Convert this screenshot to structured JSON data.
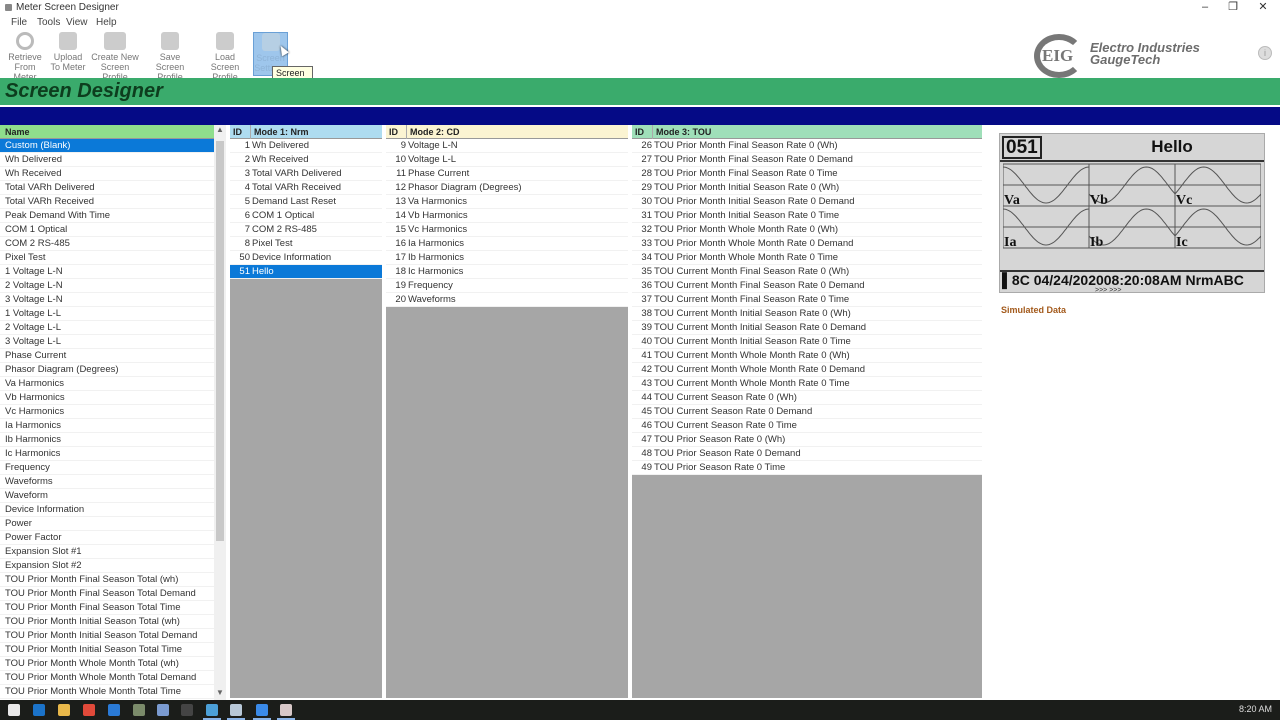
{
  "window": {
    "title": "Meter Screen Designer",
    "controls": [
      "minimize",
      "restore",
      "close"
    ]
  },
  "menu": [
    "File",
    "Tools",
    "View",
    "Help"
  ],
  "toolbar": [
    {
      "label1": "Retrieve",
      "label2": "From Meter",
      "icon": "refresh-icon"
    },
    {
      "label1": "Upload",
      "label2": "To Meter",
      "icon": "upload-icon"
    },
    {
      "label1": "Create New",
      "label2": "Screen Profile",
      "icon": "new-folder-icon"
    },
    {
      "label1": "Save",
      "label2": "Screen Profile",
      "icon": "save-icon"
    },
    {
      "label1": "Load",
      "label2": "Screen Profile",
      "icon": "load-icon"
    },
    {
      "label1": "Screen",
      "label2": "Settings",
      "icon": "settings-icon"
    }
  ],
  "tooltip": {
    "line1": "Screen",
    "line2": "Settings"
  },
  "logo": {
    "line1": "Electro Industries",
    "line2": "GaugeTech",
    "mark": "EIG"
  },
  "banner": {
    "title": "Screen Designer"
  },
  "left_list": {
    "header": "Name",
    "selected_index": 0,
    "items": [
      "Custom (Blank)",
      "Wh Delivered",
      "Wh Received",
      "Total VARh Delivered",
      "Total VARh Received",
      "Peak Demand With Time",
      "COM 1 Optical",
      "COM 2 RS-485",
      "Pixel Test",
      "1 Voltage L-N",
      "2 Voltage L-N",
      "3 Voltage L-N",
      "1 Voltage L-L",
      "2 Voltage L-L",
      "3 Voltage L-L",
      "Phase Current",
      "Phasor Diagram (Degrees)",
      "Va Harmonics",
      "Vb Harmonics",
      "Vc Harmonics",
      "Ia Harmonics",
      "Ib Harmonics",
      "Ic Harmonics",
      "Frequency",
      "Waveforms",
      "Waveform",
      "Device Information",
      "Power",
      "Power Factor",
      "Expansion Slot #1",
      "Expansion Slot #2",
      "TOU Prior Month Final Season Total (wh)",
      "TOU Prior Month Final Season Total Demand",
      "TOU Prior Month Final Season Total Time",
      "TOU Prior Month Initial Season Total (wh)",
      "TOU Prior Month Initial Season Total Demand",
      "TOU Prior Month Initial Season Total Time",
      "TOU Prior Month Whole Month Total (wh)",
      "TOU Prior Month Whole Month Total Demand",
      "TOU Prior Month Whole Month Total Time"
    ]
  },
  "mode1": {
    "id_header": "ID",
    "header": "Mode 1: Nrm",
    "selected_index": 9,
    "rows": [
      {
        "id": "1",
        "name": "Wh Delivered"
      },
      {
        "id": "2",
        "name": "Wh Received"
      },
      {
        "id": "3",
        "name": "Total VARh Delivered"
      },
      {
        "id": "4",
        "name": "Total VARh Received"
      },
      {
        "id": "5",
        "name": "Demand Last Reset"
      },
      {
        "id": "6",
        "name": "COM 1 Optical"
      },
      {
        "id": "7",
        "name": "COM 2 RS-485"
      },
      {
        "id": "8",
        "name": "Pixel Test"
      },
      {
        "id": "50",
        "name": "Device Information"
      },
      {
        "id": "51",
        "name": "Hello"
      }
    ]
  },
  "mode2": {
    "id_header": "ID",
    "header": "Mode 2: CD",
    "rows": [
      {
        "id": "9",
        "name": "Voltage L-N"
      },
      {
        "id": "10",
        "name": "Voltage L-L"
      },
      {
        "id": "11",
        "name": "Phase Current"
      },
      {
        "id": "12",
        "name": "Phasor Diagram (Degrees)"
      },
      {
        "id": "13",
        "name": "Va Harmonics"
      },
      {
        "id": "14",
        "name": "Vb Harmonics"
      },
      {
        "id": "15",
        "name": "Vc Harmonics"
      },
      {
        "id": "16",
        "name": "Ia Harmonics"
      },
      {
        "id": "17",
        "name": "Ib Harmonics"
      },
      {
        "id": "18",
        "name": "Ic Harmonics"
      },
      {
        "id": "19",
        "name": "Frequency"
      },
      {
        "id": "20",
        "name": "Waveforms"
      }
    ]
  },
  "mode3": {
    "id_header": "ID",
    "header": "Mode 3: TOU",
    "rows": [
      {
        "id": "26",
        "name": "TOU Prior Month Final Season Rate 0 (Wh)"
      },
      {
        "id": "27",
        "name": "TOU Prior Month Final Season Rate 0 Demand"
      },
      {
        "id": "28",
        "name": "TOU Prior Month Final Season Rate 0 Time"
      },
      {
        "id": "29",
        "name": "TOU Prior Month Initial Season Rate 0 (Wh)"
      },
      {
        "id": "30",
        "name": "TOU Prior Month Initial Season Rate 0 Demand"
      },
      {
        "id": "31",
        "name": "TOU Prior Month Initial Season Rate 0 Time"
      },
      {
        "id": "32",
        "name": "TOU Prior Month Whole Month Rate 0 (Wh)"
      },
      {
        "id": "33",
        "name": "TOU Prior Month Whole Month Rate 0 Demand"
      },
      {
        "id": "34",
        "name": "TOU Prior Month Whole Month Rate 0 Time"
      },
      {
        "id": "35",
        "name": "TOU Current Month Final Season Rate 0 (Wh)"
      },
      {
        "id": "36",
        "name": "TOU Current Month Final Season Rate 0 Demand"
      },
      {
        "id": "37",
        "name": "TOU Current Month Final Season Rate 0 Time"
      },
      {
        "id": "38",
        "name": "TOU Current Month Initial Season Rate 0 (Wh)"
      },
      {
        "id": "39",
        "name": "TOU Current Month Initial Season Rate 0 Demand"
      },
      {
        "id": "40",
        "name": "TOU Current Month Initial Season Rate 0 Time"
      },
      {
        "id": "41",
        "name": "TOU Current Month Whole Month Rate 0 (Wh)"
      },
      {
        "id": "42",
        "name": "TOU Current Month Whole Month Rate 0 Demand"
      },
      {
        "id": "43",
        "name": "TOU Current Month Whole Month Rate 0 Time"
      },
      {
        "id": "44",
        "name": "TOU Current Season Rate 0 (Wh)"
      },
      {
        "id": "45",
        "name": "TOU Current Season Rate 0 Demand"
      },
      {
        "id": "46",
        "name": "TOU Current Season Rate 0 Time"
      },
      {
        "id": "47",
        "name": "TOU Prior Season Rate 0 (Wh)"
      },
      {
        "id": "48",
        "name": "TOU Prior Season Rate 0 Demand"
      },
      {
        "id": "49",
        "name": "TOU Prior Season Rate 0 Time"
      }
    ]
  },
  "preview": {
    "screen_number": "051",
    "screen_title": "Hello",
    "waveform_labels": [
      "Va",
      "Vb",
      "Vc",
      "Ia",
      "Ib",
      "Ic"
    ],
    "status_line": "▌8C 04/24/202008:20:08AM  NrmABC",
    "arrows": ">>>  >>>",
    "simulated_label": "Simulated Data"
  },
  "taskbar": {
    "icons": [
      "windows-start-icon",
      "outlook-icon",
      "file-explorer-icon",
      "chrome-icon",
      "edge-icon",
      "tools-icon",
      "network-icon",
      "terminal-icon",
      "app-icon",
      "meter-designer-icon",
      "chat-icon",
      "viewer-icon"
    ],
    "clock": "8:20 AM"
  },
  "colors": {
    "banner": "#3aab6c",
    "bluebar": "#050a86",
    "selection": "#0b79d8",
    "name_header": "#8fde8c",
    "mode1_header": "#aedcf0",
    "mode2_header": "#fbf4d2",
    "mode3_header": "#9fdfb9"
  }
}
